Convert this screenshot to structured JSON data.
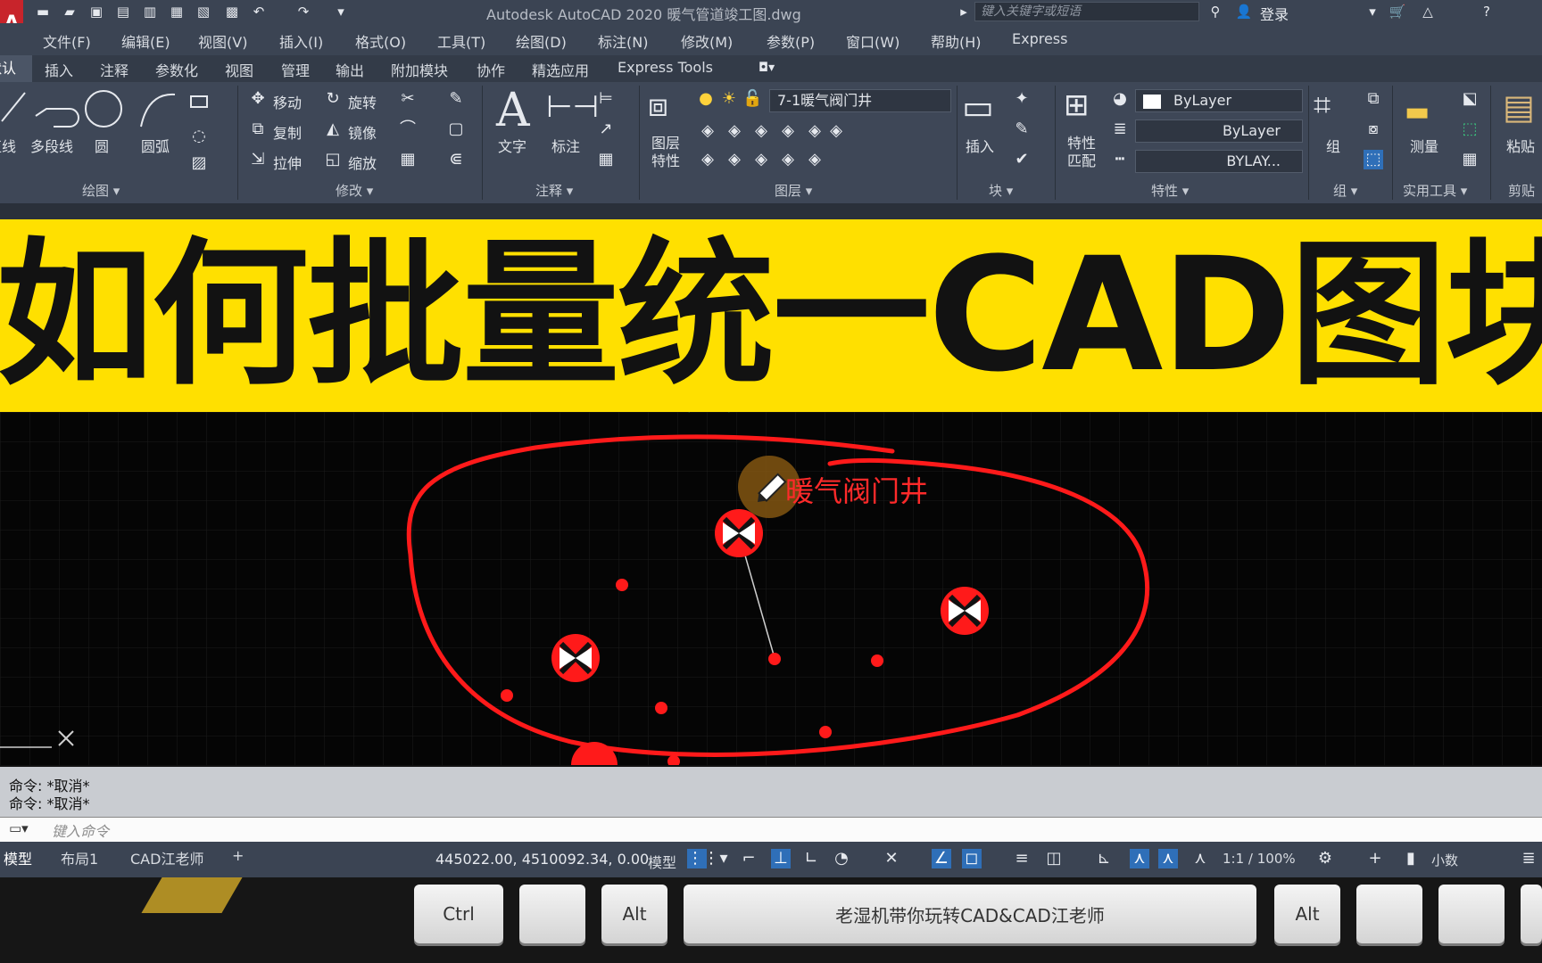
{
  "window": {
    "title": "Autodesk AutoCAD 2020    暖气管道竣工图.dwg",
    "search_placeholder": "键入关键字或短语",
    "login": "登录",
    "app_letter": "A"
  },
  "menu": [
    "文件(F)",
    "编辑(E)",
    "视图(V)",
    "插入(I)",
    "格式(O)",
    "工具(T)",
    "绘图(D)",
    "标注(N)",
    "修改(M)",
    "参数(P)",
    "窗口(W)",
    "帮助(H)",
    "Express"
  ],
  "ribbon_tabs": {
    "active": "默认",
    "items": [
      "插入",
      "注释",
      "参数化",
      "视图",
      "管理",
      "输出",
      "附加模块",
      "协作",
      "精选应用",
      "Express Tools"
    ]
  },
  "ribbon": {
    "draw": {
      "title": "绘图",
      "tools": [
        "直线",
        "多段线",
        "圆",
        "圆弧"
      ]
    },
    "modify": {
      "title": "修改",
      "tools": [
        "移动",
        "旋转",
        "复制",
        "镜像",
        "拉伸",
        "缩放"
      ]
    },
    "annotation": {
      "title": "注释",
      "tools": [
        "文字",
        "标注"
      ]
    },
    "layers": {
      "title": "图层",
      "tools": [
        "图层特性"
      ],
      "current_layer": "7-1暖气阀门井"
    },
    "block": {
      "title": "块",
      "tools": [
        "插入"
      ]
    },
    "properties": {
      "title": "特性",
      "tools": [
        "特性匹配"
      ],
      "color": "ByLayer",
      "linetype": "ByLayer",
      "lineweight": "BYLAY..."
    },
    "groups": {
      "title": "组",
      "tools": [
        "组"
      ]
    },
    "utilities": {
      "title": "实用工具",
      "tools": [
        "测量"
      ]
    },
    "clipboard": {
      "title": "剪贴",
      "tools": [
        "粘贴"
      ]
    }
  },
  "banner": {
    "text": "如何批量统一CAD图块比例"
  },
  "drawing": {
    "label": "暖气阀门井",
    "colors": {
      "entity": "#ff1a1a",
      "annotation": "#ff2a2a",
      "grid": "#1e1e1e"
    }
  },
  "command": {
    "history": [
      "命令: *取消*",
      "命令: *取消*"
    ],
    "input_placeholder": "键入命令"
  },
  "status": {
    "layout_tabs": [
      "模型",
      "布局1",
      "CAD江老师"
    ],
    "coords": "445022.00, 4510092.34, 0.00",
    "space": "模型",
    "scale": "1:1 / 100%",
    "units": "小数"
  },
  "keyboard": {
    "keys": [
      "Ctrl",
      "",
      "Alt",
      "老湿机带你玩转CAD&CAD江老师",
      "Alt",
      "",
      ""
    ]
  }
}
